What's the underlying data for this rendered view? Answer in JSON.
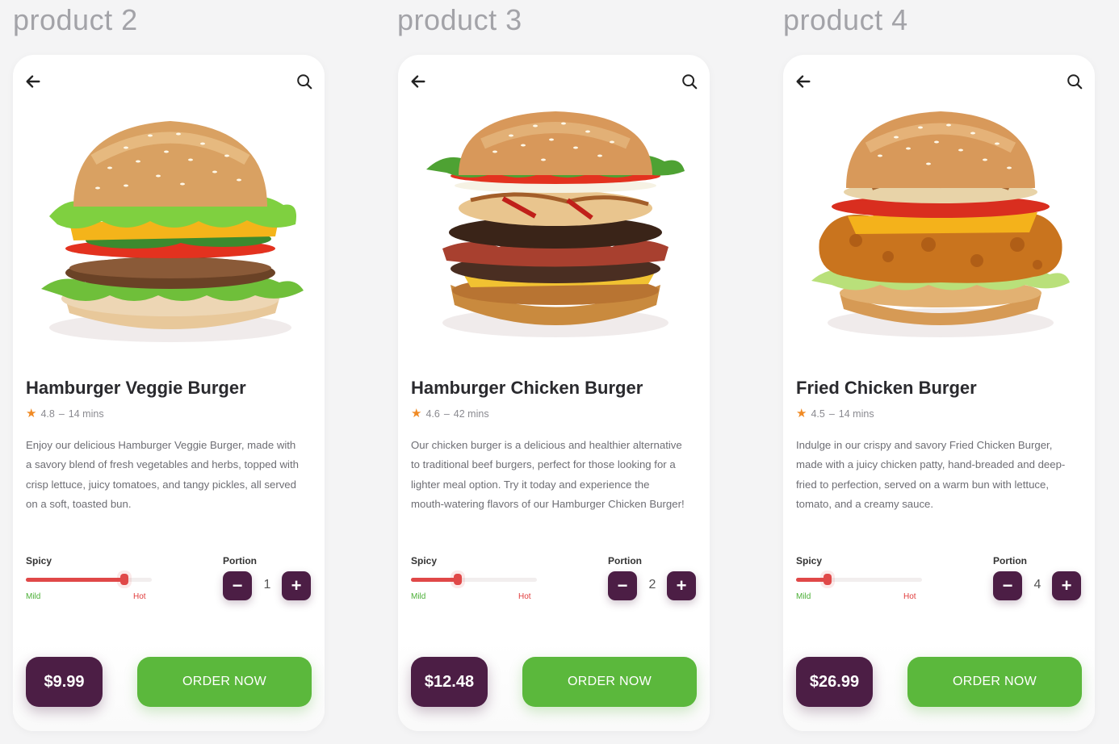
{
  "columns": [
    {
      "label": "product 2",
      "title": "Hamburger Veggie Burger",
      "rating": "4.8",
      "time": "14 mins",
      "description": "Enjoy our delicious Hamburger Veggie Burger, made with a savory blend of fresh vegetables and herbs, topped with crisp lettuce, juicy tomatoes, and tangy pickles, all served on a soft, toasted bun.",
      "spicy_label": "Spicy",
      "spicy_level": 0.78,
      "mild_label": "Mild",
      "hot_label": "Hot",
      "portion_label": "Portion",
      "portion": "1",
      "price": "$9.99",
      "order_label": "ORDER NOW",
      "burger": "veggie"
    },
    {
      "label": "product 3",
      "title": "Hamburger Chicken Burger",
      "rating": "4.6",
      "time": "42 mins",
      "description": "Our chicken burger is a delicious and healthier alternative to traditional beef burgers, perfect for those looking for a lighter meal option. Try it today and experience the mouth-watering flavors of our Hamburger Chicken Burger!",
      "spicy_label": "Spicy",
      "spicy_level": 0.37,
      "mild_label": "Mild",
      "hot_label": "Hot",
      "portion_label": "Portion",
      "portion": "2",
      "price": "$12.48",
      "order_label": "ORDER NOW",
      "burger": "chicken"
    },
    {
      "label": "product 4",
      "title": "Fried Chicken Burger",
      "rating": "4.5",
      "time": "14 mins",
      "description": "Indulge in our crispy and savory Fried Chicken Burger, made with a juicy chicken patty, hand-breaded and deep-fried to perfection, served on a warm bun with lettuce, tomato, and a creamy sauce.",
      "spicy_label": "Spicy",
      "spicy_level": 0.25,
      "mild_label": "Mild",
      "hot_label": "Hot",
      "portion_label": "Portion",
      "portion": "4",
      "price": "$26.99",
      "order_label": "ORDER NOW",
      "burger": "fried"
    }
  ],
  "icons": {
    "back": "arrow-left-icon",
    "search": "search-icon",
    "rating": "star-icon",
    "minus": "minus-icon",
    "plus": "plus-icon"
  },
  "colors": {
    "accent_dark": "#4c1e45",
    "order_green": "#5bb83c",
    "spicy_red": "#e04848",
    "star_orange": "#f08a24"
  }
}
